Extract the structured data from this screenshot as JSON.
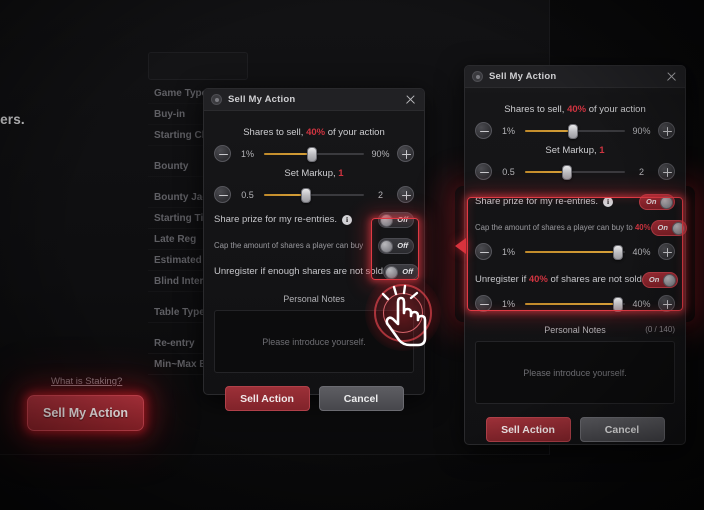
{
  "background": {
    "blurb": "ther players.",
    "staking_link": "What is Staking?",
    "sell_my_action_button": "Sell My Action",
    "spec_rows": [
      "Game Type",
      "Buy-in",
      "Starting Chips",
      "Bounty",
      "Bounty Jackpot",
      "Starting Time",
      "Late Reg",
      "Estimated Prize",
      "Blind Interval",
      "Table Type",
      "Re-entry",
      "Min~Max Buy"
    ]
  },
  "dialog_before": {
    "title": "Sell My Action",
    "close_icon": "close-icon",
    "shares": {
      "label_prefix": "Shares to sell,",
      "label_value": "40%",
      "label_suffix": "of your action",
      "min": "1%",
      "max": "90%",
      "knob_percent": 48
    },
    "markup": {
      "label_prefix": "Set Markup,",
      "label_value": "1",
      "min": "0.5",
      "max": "2",
      "knob_percent": 42
    },
    "options": [
      {
        "label": "Share prize for my re-entries.",
        "has_info": true,
        "toggle": "Off",
        "state": "off"
      },
      {
        "label": "Cap the amount of shares a player can buy",
        "has_info": false,
        "toggle": "Off",
        "state": "off"
      },
      {
        "label": "Unregister if enough shares are not sold",
        "has_info": false,
        "toggle": "Off",
        "state": "off"
      }
    ],
    "notes": {
      "title": "Personal Notes",
      "placeholder": "Please introduce yourself."
    },
    "buttons": {
      "sell": "Sell Action",
      "cancel": "Cancel"
    }
  },
  "dialog_after": {
    "title": "Sell My Action",
    "close_icon": "close-icon",
    "shares": {
      "label_prefix": "Shares to sell,",
      "label_value": "40%",
      "label_suffix": "of your action",
      "min": "1%",
      "max": "90%",
      "knob_percent": 48
    },
    "markup": {
      "label_prefix": "Set Markup,",
      "label_value": "1",
      "min": "0.5",
      "max": "2",
      "knob_percent": 42
    },
    "share_prize": {
      "label": "Share prize for my re-entries.",
      "toggle": "On"
    },
    "cap": {
      "label_prefix": "Cap the amount of shares a player can buy to",
      "label_value": "40%",
      "toggle": "On",
      "min": "1%",
      "max": "40%",
      "knob_percent": 93
    },
    "unregister": {
      "label_prefix": "Unregister if",
      "label_value": "40%",
      "label_suffix": "of shares are not sold",
      "toggle": "On",
      "min": "1%",
      "max": "40%",
      "knob_percent": 93
    },
    "notes": {
      "title": "Personal Notes",
      "count": "(0 / 140)",
      "placeholder": "Please introduce yourself."
    },
    "buttons": {
      "sell": "Sell Action",
      "cancel": "Cancel"
    }
  },
  "annotations": {
    "tap_gesture_icon": "tap-hand-icon",
    "arrow_icon": "arrow-left-icon",
    "highlight_color": "#e03a44",
    "accent_color": "#cf3440",
    "slider_fill_color": "#d8a23a"
  }
}
